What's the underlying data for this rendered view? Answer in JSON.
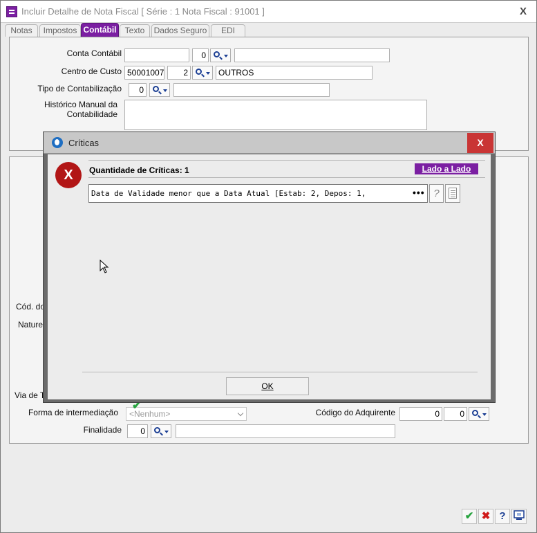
{
  "window": {
    "title": "Incluir Detalhe de Nota Fiscal [ Série : 1   Nota Fiscal : 91001 ]",
    "close_glyph": "X"
  },
  "tabs": [
    {
      "label": "Notas",
      "active": false
    },
    {
      "label": "Impostos",
      "active": false
    },
    {
      "label": "Contábil",
      "active": true
    },
    {
      "label": "Texto",
      "active": false
    },
    {
      "label": "Dados Seguro",
      "active": false
    },
    {
      "label": "EDI",
      "active": false
    }
  ],
  "form": {
    "conta_contabil": {
      "label": "Conta Contábil",
      "code": "",
      "digit": "0",
      "description": ""
    },
    "centro_custo": {
      "label": "Centro de Custo",
      "code": "50001007",
      "digit": "2",
      "description": "OUTROS"
    },
    "tipo_contabilizacao": {
      "label": "Tipo de Contabilização",
      "code": "0",
      "description": ""
    },
    "historico": {
      "label_line1": "Histórico Manual da",
      "label_line2": "Contabilidade",
      "value": ""
    }
  },
  "lower_form": {
    "cod_label_partial": "Cód. do",
    "natureza_label_partial": "Nature",
    "via_label_partial": "Via de Tr",
    "forma_intermediacao": {
      "label": "Forma de intermediação",
      "value": "<Nenhum>"
    },
    "codigo_adquirente": {
      "label": "Código do Adquirente",
      "value1": "0",
      "value2": "0"
    },
    "finalidade": {
      "label": "Finalidade",
      "code": "0",
      "description": ""
    }
  },
  "dialog": {
    "title": "Críticas",
    "close_glyph": "X",
    "error_glyph": "X",
    "quantity_label": "Quantidade de Críticas: 1",
    "lado_a_lado_label": "Lado a Lado",
    "critica_text": "Data de Validade menor que a Data Atual [Estab: 2, Depos: 1,",
    "more_glyph": "•••",
    "help_glyph": "?",
    "ok_label": "OK"
  },
  "footer": {
    "confirm_glyph": "✔",
    "cancel_glyph": "✖",
    "help_glyph": "?"
  },
  "colors": {
    "accent": "#7b1fa2",
    "error": "#b21616",
    "close_red": "#c93535",
    "confirm_green": "#27a33f"
  }
}
